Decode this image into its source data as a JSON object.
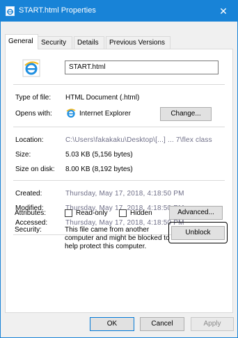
{
  "window": {
    "title": "START.html Properties",
    "close_glyph": "✕",
    "accent_color": "#1883d7"
  },
  "tabs": [
    {
      "label": "General",
      "active": true
    },
    {
      "label": "Security",
      "active": false
    },
    {
      "label": "Details",
      "active": false
    },
    {
      "label": "Previous Versions",
      "active": false
    }
  ],
  "general": {
    "file_name": "START.html",
    "type_of_file": {
      "label": "Type of file:",
      "value": "HTML Document (.html)"
    },
    "opens_with": {
      "label": "Opens with:",
      "app": "Internet Explorer",
      "button": "Change..."
    },
    "location": {
      "label": "Location:",
      "value": "C:\\Users\\fakakaku\\Desktop\\[...] ... 7\\flex class"
    },
    "size": {
      "label": "Size:",
      "value": "5.03 KB (5,156 bytes)"
    },
    "size_on_disk": {
      "label": "Size on disk:",
      "value": "8.00 KB (8,192 bytes)"
    },
    "created": {
      "label": "Created:",
      "value": "Thursday, May 17, 2018, 4:18:50 PM"
    },
    "modified": {
      "label": "Modified:",
      "value": "Thursday, May 17, 2018, 4:18:50 PM"
    },
    "accessed": {
      "label": "Accessed:",
      "value": "Thursday, May 17, 2018, 4:18:50 PM"
    },
    "attributes": {
      "label": "Attributes:",
      "readonly": "Read-only",
      "hidden": "Hidden",
      "advanced_button": "Advanced..."
    },
    "security": {
      "label": "Security:",
      "line1": "This file came from another",
      "line2": "computer and might be blocked to",
      "line3": "help protect this computer.",
      "unblock_button": "Unblock"
    }
  },
  "footer": {
    "ok": "OK",
    "cancel": "Cancel",
    "apply": "Apply"
  }
}
